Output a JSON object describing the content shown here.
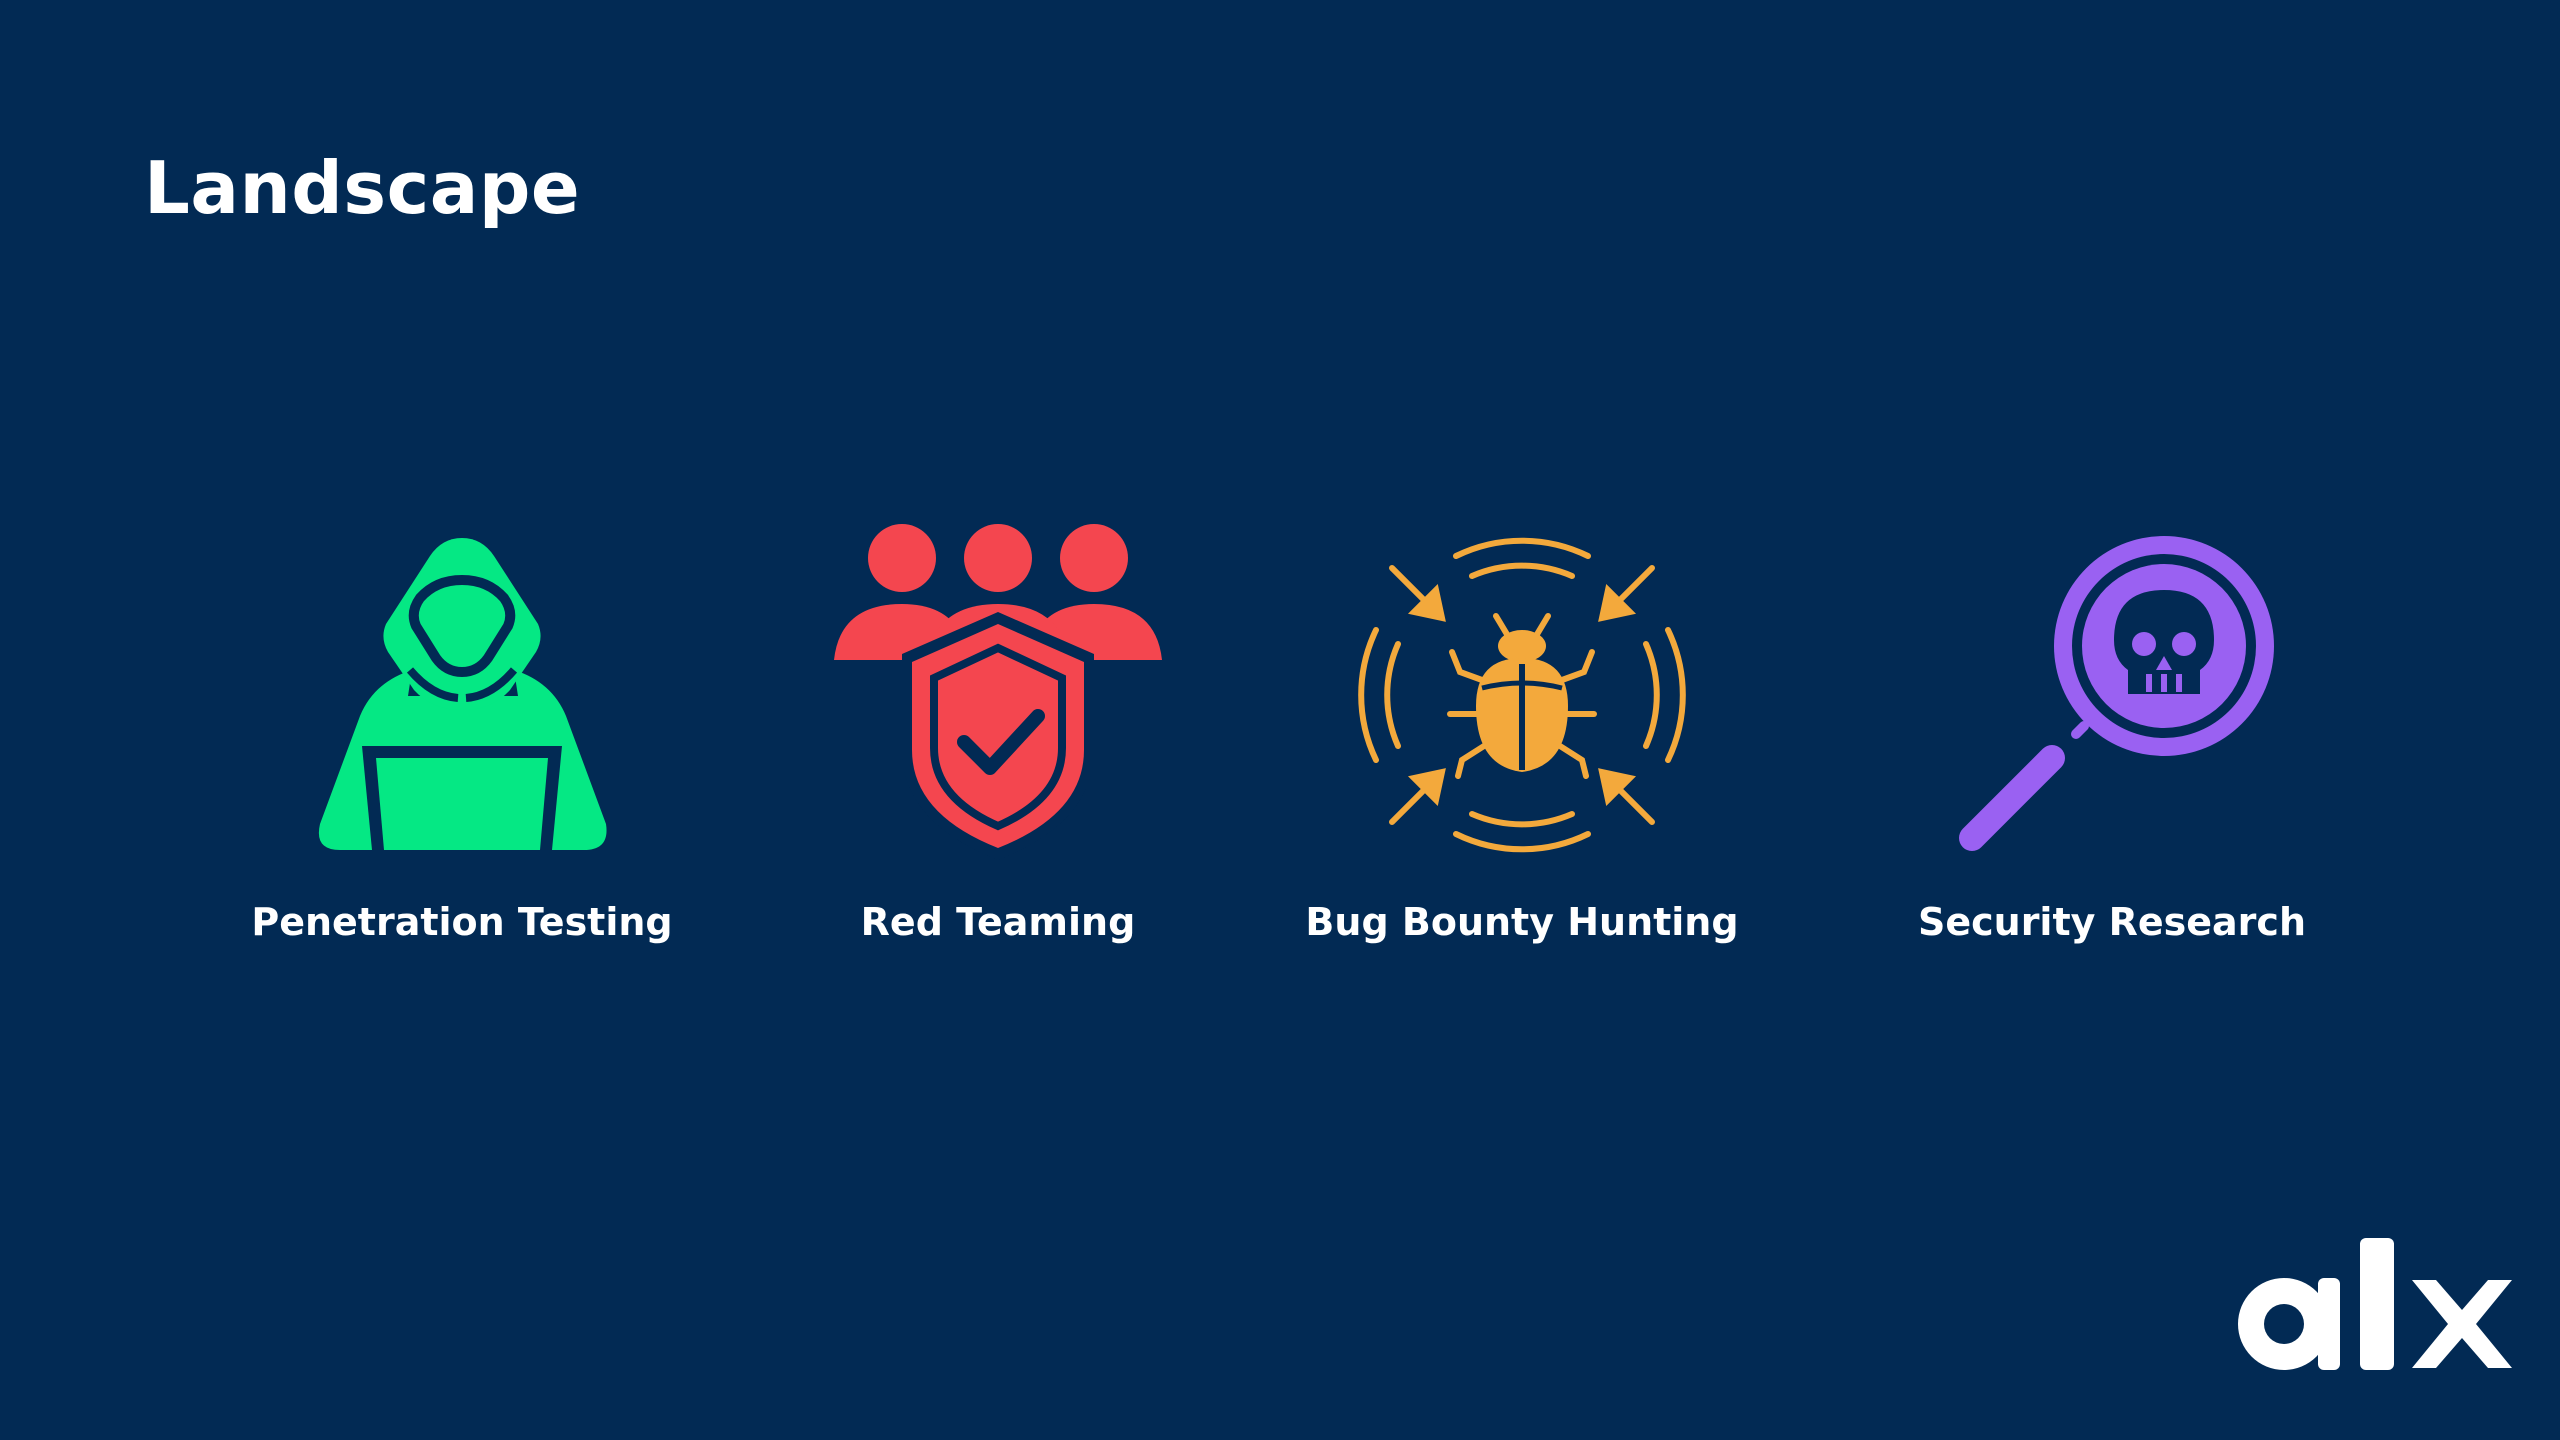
{
  "slide": {
    "title": "Landscape",
    "background": "#022a54"
  },
  "items": [
    {
      "label": "Penetration Testing",
      "icon": "hooded-hacker-icon",
      "color": "#05e884"
    },
    {
      "label": "Red Teaming",
      "icon": "team-shield-check-icon",
      "color": "#f4464f"
    },
    {
      "label": "Bug Bounty Hunting",
      "icon": "bug-target-icon",
      "color": "#f3a93c"
    },
    {
      "label": "Security Research",
      "icon": "magnifier-skull-icon",
      "color": "#9a61f2"
    }
  ],
  "logo": {
    "text": "alx",
    "color": "#ffffff"
  }
}
